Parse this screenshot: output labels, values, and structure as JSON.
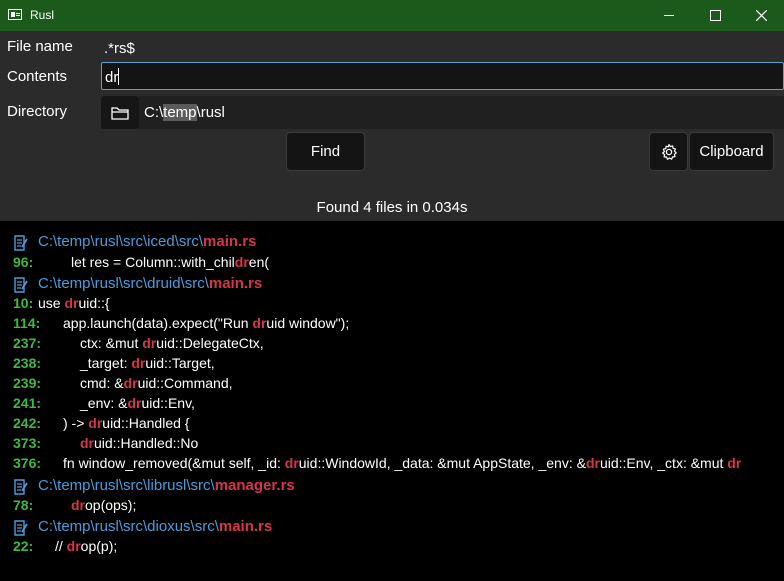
{
  "window": {
    "title": "Rusl"
  },
  "form": {
    "filename_label": "File name",
    "filename_value": ".*rs$",
    "contents_label": "Contents",
    "contents_value": "dr",
    "directory_label": "Directory",
    "directory_prefix": "C:\\",
    "directory_selected": "temp",
    "directory_suffix": "\\rusl"
  },
  "buttons": {
    "find": "Find",
    "clipboard": "Clipboard"
  },
  "status": "Found 4 files in 0.034s",
  "results": [
    {
      "type": "file",
      "dir": "C:\\temp\\rusl\\src\\iced\\src\\",
      "name": "main.rs"
    },
    {
      "type": "line",
      "num": "96:",
      "indent": 71,
      "parts": [
        "let res = Column::with_chil",
        "dr",
        "en("
      ]
    },
    {
      "type": "file",
      "dir": "C:\\temp\\rusl\\src\\druid\\src\\",
      "name": "main.rs"
    },
    {
      "type": "line",
      "num": "10:",
      "indent": 38,
      "parts": [
        "use ",
        "dr",
        "uid::{"
      ]
    },
    {
      "type": "line",
      "num": "114:",
      "indent": 63,
      "parts": [
        "app.launch(data).expect(\"Run ",
        "dr",
        "uid window\");"
      ]
    },
    {
      "type": "line",
      "num": "237:",
      "indent": 80,
      "parts": [
        "ctx: &mut ",
        "dr",
        "uid::DelegateCtx,"
      ]
    },
    {
      "type": "line",
      "num": "238:",
      "indent": 80,
      "parts": [
        "_target: ",
        "dr",
        "uid::Target,"
      ]
    },
    {
      "type": "line",
      "num": "239:",
      "indent": 80,
      "parts": [
        "cmd: &",
        "dr",
        "uid::Command,"
      ]
    },
    {
      "type": "line",
      "num": "241:",
      "indent": 80,
      "parts": [
        "_env: &",
        "dr",
        "uid::Env,"
      ]
    },
    {
      "type": "line",
      "num": "242:",
      "indent": 63,
      "parts": [
        ") -> ",
        "dr",
        "uid::Handled {"
      ]
    },
    {
      "type": "line",
      "num": "373:",
      "indent": 80,
      "parts": [
        "",
        "dr",
        "uid::Handled::No"
      ]
    },
    {
      "type": "line",
      "num": "376:",
      "indent": 63,
      "parts": [
        "fn window_removed(&mut self, _id: ",
        "dr",
        "uid::WindowId, _data: &mut AppState, _env: &",
        "dr",
        "uid::Env, _ctx: &mut ",
        "dr"
      ]
    },
    {
      "type": "file",
      "dir": "C:\\temp\\rusl\\src\\librusl\\src\\",
      "name": "manager.rs"
    },
    {
      "type": "line",
      "num": "78:",
      "indent": 71,
      "parts": [
        "",
        "dr",
        "op(ops);"
      ]
    },
    {
      "type": "file",
      "dir": "C:\\temp\\rusl\\src\\dioxus\\src\\",
      "name": "main.rs"
    },
    {
      "type": "line",
      "num": "22:",
      "indent": 55,
      "parts": [
        "//     ",
        "dr",
        "op(p);"
      ]
    }
  ],
  "icons": {
    "app": "app-window-icon",
    "folder": "folder-icon",
    "settings": "gear-icon",
    "file": "document-icon"
  },
  "colors": {
    "titlebar": "#1b5a1b",
    "panel": "#2b2b2b",
    "path": "#4a9ddb",
    "highlight": "#d6364a",
    "line_number": "#3fb93f",
    "focus_border": "#5da1d0"
  }
}
